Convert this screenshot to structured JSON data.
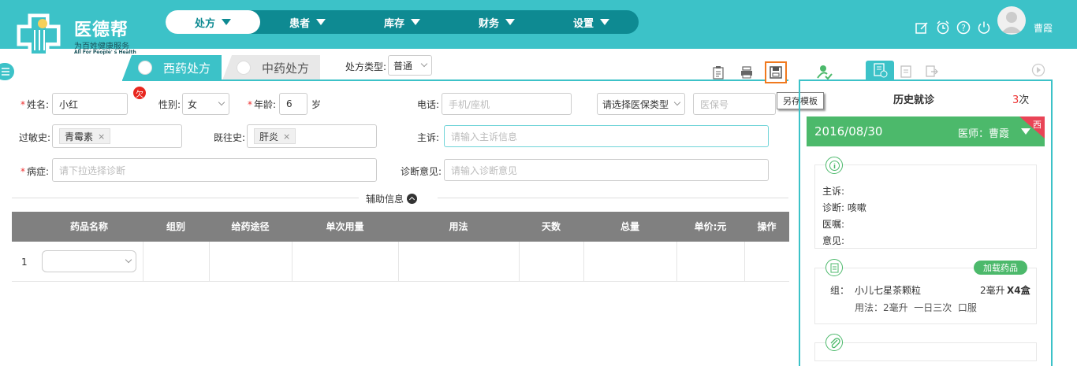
{
  "brand": {
    "name": "医德帮",
    "sub": "为百姓健康服务",
    "en": "All For People' s Health"
  },
  "nav": {
    "items": [
      "处方",
      "患者",
      "库存",
      "财务",
      "设置"
    ]
  },
  "user": {
    "name": "曹霞"
  },
  "tabs": {
    "west": "西药处方",
    "chinese": "中药处方"
  },
  "rx_type": {
    "label": "处方类型:",
    "value": "普通"
  },
  "form": {
    "name_label": "姓名:",
    "name_value": "小红",
    "owe_badge": "欠",
    "gender_label": "性别:",
    "gender_value": "女",
    "age_label": "年龄:",
    "age_value": "6",
    "age_unit": "岁",
    "phone_label": "电话:",
    "phone_placeholder": "手机/座机",
    "insurance_type_placeholder": "请选择医保类型",
    "insurance_no_placeholder": "医保号",
    "allergy_label": "过敏史:",
    "allergy_tag": "青霉素",
    "history_label": "既往史:",
    "history_tag": "肝炎",
    "complaint_label": "主诉:",
    "complaint_placeholder": "请输入主诉信息",
    "disease_label": "病症:",
    "disease_placeholder": "请下拉选择诊断",
    "opinion_label": "诊断意见:",
    "opinion_placeholder": "请输入诊断意见",
    "tag_close": "×"
  },
  "aux_label": "辅助信息",
  "table": {
    "headers": [
      "药品名称",
      "组别",
      "给药途径",
      "单次用量",
      "用法",
      "天数",
      "总量",
      "单价:元",
      "操作"
    ],
    "row_index": "1"
  },
  "tooltip": "另存模板",
  "history": {
    "title": "历史就诊",
    "count": "3",
    "count_unit": "次",
    "date": "2016/08/30",
    "doctor": "医师：曹霞",
    "corner": "西",
    "complaint_label": "主诉:",
    "diagnosis_label": "诊断:",
    "diagnosis_value": "咳嗽",
    "advice_label": "医嘱:",
    "opinion_label": "意见:",
    "load_button": "加载药品",
    "group_label": "组：",
    "drug_name": "小儿七星茶颗粒",
    "drug_dose": "2毫升",
    "drug_qty": "X4盒",
    "usage": "用法：2毫升  一日三次  口服"
  },
  "colors": {
    "accent": "#3cc2c8",
    "nav_dark": "#0e8a92",
    "green": "#4cb96b",
    "red": "#e94456",
    "highlight": "#f0791e"
  }
}
